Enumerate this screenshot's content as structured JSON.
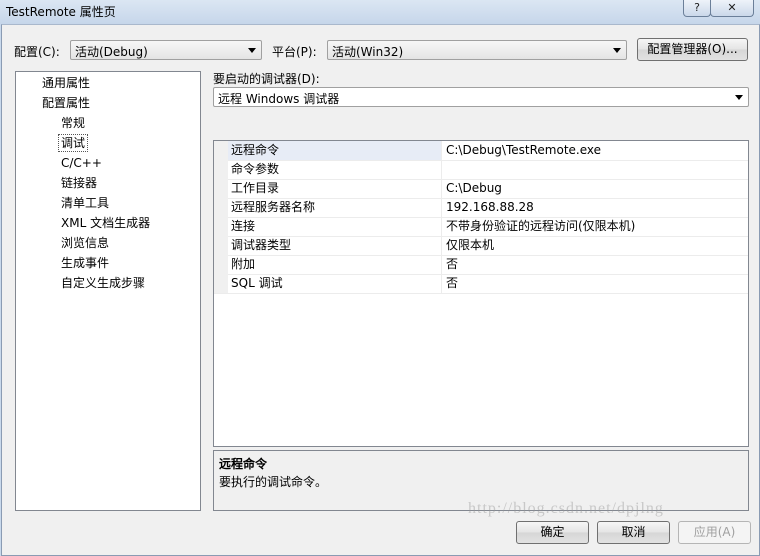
{
  "window": {
    "title": "TestRemote 属性页",
    "help_label": "?",
    "close_label": "✕"
  },
  "config_bar": {
    "config_label": "配置(C):",
    "config_value": "活动(Debug)",
    "platform_label": "平台(P):",
    "platform_value": "活动(Win32)",
    "manager_button": "配置管理器(O)..."
  },
  "tree": {
    "items": [
      {
        "label": "通用属性"
      },
      {
        "label": "配置属性"
      },
      {
        "label": "常规"
      },
      {
        "label": "调试",
        "selected": true
      },
      {
        "label": "C/C++"
      },
      {
        "label": "链接器"
      },
      {
        "label": "清单工具"
      },
      {
        "label": "XML 文档生成器"
      },
      {
        "label": "浏览信息"
      },
      {
        "label": "生成事件"
      },
      {
        "label": "自定义生成步骤"
      }
    ]
  },
  "debugger": {
    "label": "要启动的调试器(D):",
    "value": "远程 Windows 调试器"
  },
  "properties": [
    {
      "name": "远程命令",
      "value": "C:\\Debug\\TestRemote.exe",
      "selected": true
    },
    {
      "name": "命令参数",
      "value": ""
    },
    {
      "name": "工作目录",
      "value": "C:\\Debug"
    },
    {
      "name": "远程服务器名称",
      "value": "192.168.88.28"
    },
    {
      "name": "连接",
      "value": "不带身份验证的远程访问(仅限本机)"
    },
    {
      "name": "调试器类型",
      "value": "仅限本机"
    },
    {
      "name": "附加",
      "value": "否"
    },
    {
      "name": "SQL 调试",
      "value": "否"
    }
  ],
  "description": {
    "title": "远程命令",
    "text": "要执行的调试命令。"
  },
  "footer": {
    "ok": "确定",
    "cancel": "取消",
    "apply": "应用(A)",
    "watermark": "http://blog.csdn.net/dpjlng"
  }
}
